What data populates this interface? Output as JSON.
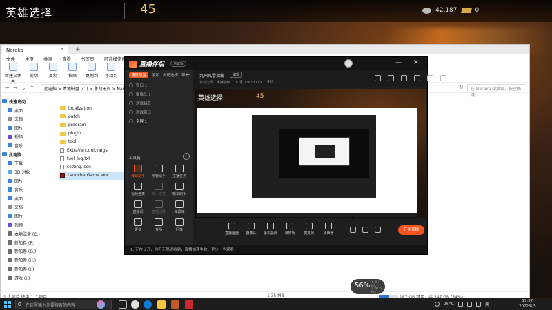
{
  "game": {
    "title": "英雄选择",
    "countdown": "45",
    "currency_1": "42,187",
    "currency_2": "0"
  },
  "explorer": {
    "tab_title": "Naraka",
    "ribbon_bar": [
      "文件",
      "主页",
      "共享",
      "查看",
      "书签页",
      "可选择常用工具、文件夹共享、点击按钮"
    ],
    "tools": [
      {
        "label": "新建文件夹"
      },
      {
        "label": "剪切"
      },
      {
        "label": "复制"
      },
      {
        "label": "粘贴"
      },
      {
        "label": "复制到"
      },
      {
        "label": "移动到"
      }
    ],
    "address": "此电脑 > 本地磁盘 (C:) > 永劫无间 > Naraka",
    "search_placeholder": "在 Naraka 中搜索，按空格键",
    "sidebar": [
      {
        "label": "快速访问",
        "level": "top",
        "color": "#3a86d6"
      },
      {
        "label": "桌面",
        "level": "child",
        "color": "#3a86d6"
      },
      {
        "label": "文档",
        "level": "child",
        "color": "#8d8d8d"
      },
      {
        "label": "图片",
        "level": "child",
        "color": "#3a86d6"
      },
      {
        "label": "视频",
        "level": "child",
        "color": "#6b4fd6"
      },
      {
        "label": "音乐",
        "level": "child",
        "color": "#3a86d6"
      },
      {
        "label": "此电脑",
        "level": "top",
        "color": "#3a86d6"
      },
      {
        "label": "下载",
        "level": "child",
        "color": "#3a86d6"
      },
      {
        "label": "3D 对象",
        "level": "child",
        "color": "#5aa6e6"
      },
      {
        "label": "图片",
        "level": "child",
        "color": "#3a86d6"
      },
      {
        "label": "音乐",
        "level": "child",
        "color": "#3a86d6"
      },
      {
        "label": "桌面",
        "level": "child",
        "color": "#3a86d6"
      },
      {
        "label": "文档",
        "level": "child",
        "color": "#8d8d8d"
      },
      {
        "label": "图片",
        "level": "child",
        "color": "#3a86d6"
      },
      {
        "label": "视频",
        "level": "child",
        "color": "#6b4fd6"
      },
      {
        "label": "本地磁盘 (C:)",
        "level": "child",
        "color": "#6d6d6d"
      },
      {
        "label": "新加卷 (F:)",
        "level": "child",
        "color": "#6d6d6d"
      },
      {
        "label": "新加卷 (G:)",
        "level": "child",
        "color": "#6d6d6d"
      },
      {
        "label": "新加卷 (H:)",
        "level": "child",
        "color": "#6d6d6d"
      },
      {
        "label": "新加卷 (I:)",
        "level": "child",
        "color": "#6d6d6d"
      },
      {
        "label": "游戏 (J:)",
        "level": "child",
        "color": "#6d6d6d"
      }
    ],
    "files": [
      {
        "name": "localization",
        "type": "folder"
      },
      {
        "name": "patch",
        "type": "folder"
      },
      {
        "name": "program",
        "type": "folder"
      },
      {
        "name": "plugin",
        "type": "folder"
      },
      {
        "name": "tool",
        "type": "folder"
      },
      {
        "name": "ExtraVars.unityargs",
        "type": "doc"
      },
      {
        "name": "fuel_log.txt",
        "type": "doc"
      },
      {
        "name": "setting.json",
        "type": "doc"
      },
      {
        "name": "LauncherGame.exe",
        "type": "exe"
      }
    ],
    "status_left": "1 个项目 选中 1 个项目",
    "status_mid": "1.35 MB",
    "status_right": "187 GB 可用，共 347 GB (54%)",
    "disk_used_percent": 54
  },
  "stream": {
    "app_name": "直播伴侣",
    "version": "测试版",
    "left_tabs": [
      "场景设置",
      "添加",
      "布局选择",
      "导入"
    ],
    "scenes": [
      {
        "label": "窗口 1"
      },
      {
        "label": "摄像头 1"
      },
      {
        "label": "游戏捕获"
      },
      {
        "label": "游戏窗口"
      },
      {
        "label": "全屏 1"
      }
    ],
    "toolbox_label": "工具箱",
    "tools": [
      {
        "label": "弹幕助手",
        "state": "accent"
      },
      {
        "label": "房管助手",
        "state": "normal"
      },
      {
        "label": "主播任务",
        "state": "normal"
      },
      {
        "label": "视频连麦",
        "state": "normal"
      },
      {
        "label": "多人连麦",
        "state": "disabled"
      },
      {
        "label": "精华助手",
        "state": "normal"
      },
      {
        "label": "直播间",
        "state": "normal"
      },
      {
        "label": "直播回放",
        "state": "disabled"
      },
      {
        "label": "弹幕库",
        "state": "normal"
      },
      {
        "label": "更多",
        "state": "normal"
      },
      {
        "label": "直播",
        "state": "normal"
      },
      {
        "label": "回放",
        "state": "normal"
      }
    ],
    "room_title": "九州风雷指南",
    "room_edit": "编辑",
    "room_meta": [
      "永劫无间 · 大神操作",
      "ID号 13613773",
      "491"
    ],
    "controls": [
      {
        "label": "直播画面"
      },
      {
        "label": "摄像头"
      },
      {
        "label": "手机投屏"
      },
      {
        "label": "录屏功"
      },
      {
        "label": "麦克风"
      },
      {
        "label": "扬声器"
      }
    ],
    "start_label": "开始直播",
    "status_text": "1. 正在公开，你可无障碍看到，直播加速生效，更少一些观看"
  },
  "perf": {
    "percent": "56%",
    "up": "↑ 0.7 K/s",
    "down": "↓ 41.5 K/s"
  },
  "taskbar": {
    "search_placeholder": "在这里输入你要搜索的内容",
    "temperature": "26°C",
    "lang": "英",
    "time": "19:57",
    "date": "2022/6/5"
  }
}
